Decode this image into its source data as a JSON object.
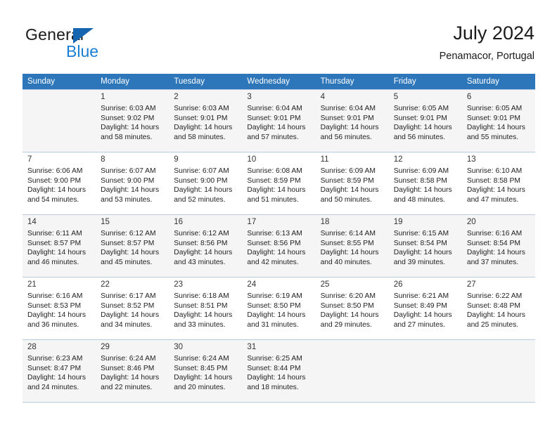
{
  "brand": {
    "name_top": "General",
    "name_bottom": "Blue",
    "accent_color": "#1a7fd4",
    "triangle_color": "#1565b0"
  },
  "header": {
    "title": "July 2024",
    "subtitle": "Penamacor, Portugal"
  },
  "theme": {
    "header_row_bg": "#2e76ba",
    "header_row_text": "#ffffff",
    "row_shaded_bg": "#f5f5f5",
    "grid_line": "#b9cde2"
  },
  "weekdays": [
    "Sunday",
    "Monday",
    "Tuesday",
    "Wednesday",
    "Thursday",
    "Friday",
    "Saturday"
  ],
  "labels": {
    "sunrise_prefix": "Sunrise:",
    "sunset_prefix": "Sunset:",
    "daylight_prefix": "Daylight:"
  },
  "weeks": [
    [
      {
        "day": "",
        "line1": "",
        "line2": "",
        "line3": "",
        "line4": ""
      },
      {
        "day": "1",
        "line1": "Sunrise: 6:03 AM",
        "line2": "Sunset: 9:02 PM",
        "line3": "Daylight: 14 hours",
        "line4": "and 58 minutes."
      },
      {
        "day": "2",
        "line1": "Sunrise: 6:03 AM",
        "line2": "Sunset: 9:01 PM",
        "line3": "Daylight: 14 hours",
        "line4": "and 58 minutes."
      },
      {
        "day": "3",
        "line1": "Sunrise: 6:04 AM",
        "line2": "Sunset: 9:01 PM",
        "line3": "Daylight: 14 hours",
        "line4": "and 57 minutes."
      },
      {
        "day": "4",
        "line1": "Sunrise: 6:04 AM",
        "line2": "Sunset: 9:01 PM",
        "line3": "Daylight: 14 hours",
        "line4": "and 56 minutes."
      },
      {
        "day": "5",
        "line1": "Sunrise: 6:05 AM",
        "line2": "Sunset: 9:01 PM",
        "line3": "Daylight: 14 hours",
        "line4": "and 56 minutes."
      },
      {
        "day": "6",
        "line1": "Sunrise: 6:05 AM",
        "line2": "Sunset: 9:01 PM",
        "line3": "Daylight: 14 hours",
        "line4": "and 55 minutes."
      }
    ],
    [
      {
        "day": "7",
        "line1": "Sunrise: 6:06 AM",
        "line2": "Sunset: 9:00 PM",
        "line3": "Daylight: 14 hours",
        "line4": "and 54 minutes."
      },
      {
        "day": "8",
        "line1": "Sunrise: 6:07 AM",
        "line2": "Sunset: 9:00 PM",
        "line3": "Daylight: 14 hours",
        "line4": "and 53 minutes."
      },
      {
        "day": "9",
        "line1": "Sunrise: 6:07 AM",
        "line2": "Sunset: 9:00 PM",
        "line3": "Daylight: 14 hours",
        "line4": "and 52 minutes."
      },
      {
        "day": "10",
        "line1": "Sunrise: 6:08 AM",
        "line2": "Sunset: 8:59 PM",
        "line3": "Daylight: 14 hours",
        "line4": "and 51 minutes."
      },
      {
        "day": "11",
        "line1": "Sunrise: 6:09 AM",
        "line2": "Sunset: 8:59 PM",
        "line3": "Daylight: 14 hours",
        "line4": "and 50 minutes."
      },
      {
        "day": "12",
        "line1": "Sunrise: 6:09 AM",
        "line2": "Sunset: 8:58 PM",
        "line3": "Daylight: 14 hours",
        "line4": "and 48 minutes."
      },
      {
        "day": "13",
        "line1": "Sunrise: 6:10 AM",
        "line2": "Sunset: 8:58 PM",
        "line3": "Daylight: 14 hours",
        "line4": "and 47 minutes."
      }
    ],
    [
      {
        "day": "14",
        "line1": "Sunrise: 6:11 AM",
        "line2": "Sunset: 8:57 PM",
        "line3": "Daylight: 14 hours",
        "line4": "and 46 minutes."
      },
      {
        "day": "15",
        "line1": "Sunrise: 6:12 AM",
        "line2": "Sunset: 8:57 PM",
        "line3": "Daylight: 14 hours",
        "line4": "and 45 minutes."
      },
      {
        "day": "16",
        "line1": "Sunrise: 6:12 AM",
        "line2": "Sunset: 8:56 PM",
        "line3": "Daylight: 14 hours",
        "line4": "and 43 minutes."
      },
      {
        "day": "17",
        "line1": "Sunrise: 6:13 AM",
        "line2": "Sunset: 8:56 PM",
        "line3": "Daylight: 14 hours",
        "line4": "and 42 minutes."
      },
      {
        "day": "18",
        "line1": "Sunrise: 6:14 AM",
        "line2": "Sunset: 8:55 PM",
        "line3": "Daylight: 14 hours",
        "line4": "and 40 minutes."
      },
      {
        "day": "19",
        "line1": "Sunrise: 6:15 AM",
        "line2": "Sunset: 8:54 PM",
        "line3": "Daylight: 14 hours",
        "line4": "and 39 minutes."
      },
      {
        "day": "20",
        "line1": "Sunrise: 6:16 AM",
        "line2": "Sunset: 8:54 PM",
        "line3": "Daylight: 14 hours",
        "line4": "and 37 minutes."
      }
    ],
    [
      {
        "day": "21",
        "line1": "Sunrise: 6:16 AM",
        "line2": "Sunset: 8:53 PM",
        "line3": "Daylight: 14 hours",
        "line4": "and 36 minutes."
      },
      {
        "day": "22",
        "line1": "Sunrise: 6:17 AM",
        "line2": "Sunset: 8:52 PM",
        "line3": "Daylight: 14 hours",
        "line4": "and 34 minutes."
      },
      {
        "day": "23",
        "line1": "Sunrise: 6:18 AM",
        "line2": "Sunset: 8:51 PM",
        "line3": "Daylight: 14 hours",
        "line4": "and 33 minutes."
      },
      {
        "day": "24",
        "line1": "Sunrise: 6:19 AM",
        "line2": "Sunset: 8:50 PM",
        "line3": "Daylight: 14 hours",
        "line4": "and 31 minutes."
      },
      {
        "day": "25",
        "line1": "Sunrise: 6:20 AM",
        "line2": "Sunset: 8:50 PM",
        "line3": "Daylight: 14 hours",
        "line4": "and 29 minutes."
      },
      {
        "day": "26",
        "line1": "Sunrise: 6:21 AM",
        "line2": "Sunset: 8:49 PM",
        "line3": "Daylight: 14 hours",
        "line4": "and 27 minutes."
      },
      {
        "day": "27",
        "line1": "Sunrise: 6:22 AM",
        "line2": "Sunset: 8:48 PM",
        "line3": "Daylight: 14 hours",
        "line4": "and 25 minutes."
      }
    ],
    [
      {
        "day": "28",
        "line1": "Sunrise: 6:23 AM",
        "line2": "Sunset: 8:47 PM",
        "line3": "Daylight: 14 hours",
        "line4": "and 24 minutes."
      },
      {
        "day": "29",
        "line1": "Sunrise: 6:24 AM",
        "line2": "Sunset: 8:46 PM",
        "line3": "Daylight: 14 hours",
        "line4": "and 22 minutes."
      },
      {
        "day": "30",
        "line1": "Sunrise: 6:24 AM",
        "line2": "Sunset: 8:45 PM",
        "line3": "Daylight: 14 hours",
        "line4": "and 20 minutes."
      },
      {
        "day": "31",
        "line1": "Sunrise: 6:25 AM",
        "line2": "Sunset: 8:44 PM",
        "line3": "Daylight: 14 hours",
        "line4": "and 18 minutes."
      },
      {
        "day": "",
        "line1": "",
        "line2": "",
        "line3": "",
        "line4": ""
      },
      {
        "day": "",
        "line1": "",
        "line2": "",
        "line3": "",
        "line4": ""
      },
      {
        "day": "",
        "line1": "",
        "line2": "",
        "line3": "",
        "line4": ""
      }
    ]
  ]
}
